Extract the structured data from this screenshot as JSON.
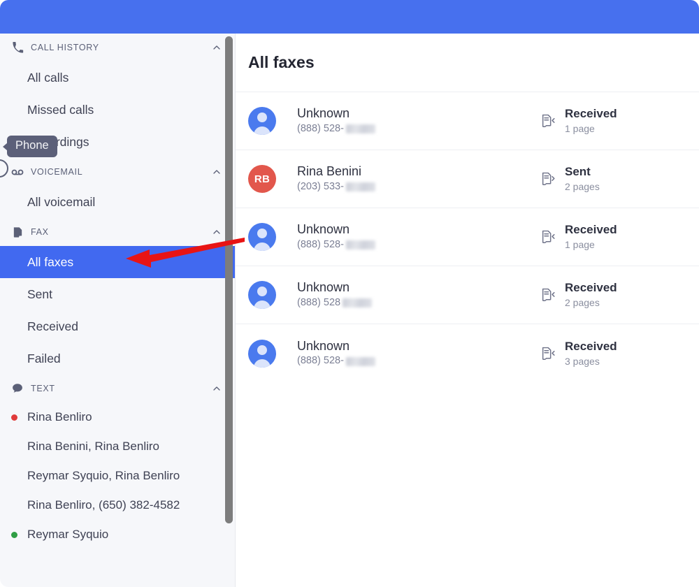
{
  "window": {
    "topbar_color": "#4770ee",
    "accent_color": "#4169f0"
  },
  "tooltip": {
    "text": "Phone"
  },
  "sidebar": {
    "sections": [
      {
        "id": "call-history",
        "icon": "phone-icon",
        "title": "CALL HISTORY",
        "collapse_icon": "chevron-up-icon",
        "items": [
          {
            "label": "All calls",
            "selected": false
          },
          {
            "label": "Missed calls",
            "selected": false
          },
          {
            "label": "Recordings",
            "selected": false
          }
        ]
      },
      {
        "id": "voicemail",
        "icon": "voicemail-icon",
        "title": "VOICEMAIL",
        "collapse_icon": "chevron-up-icon",
        "items": [
          {
            "label": "All voicemail",
            "selected": false
          }
        ]
      },
      {
        "id": "fax",
        "icon": "fax-document-icon",
        "title": "FAX",
        "collapse_icon": "chevron-up-icon",
        "items": [
          {
            "label": "All faxes",
            "selected": true
          },
          {
            "label": "Sent",
            "selected": false
          },
          {
            "label": "Received",
            "selected": false
          },
          {
            "label": "Failed",
            "selected": false
          }
        ]
      },
      {
        "id": "text",
        "icon": "chat-bubble-icon",
        "title": "TEXT",
        "collapse_icon": "chevron-up-icon",
        "threads": [
          {
            "label": "Rina Benliro",
            "dot": "red"
          },
          {
            "label": "Rina Benini, Rina Benliro",
            "dot": "none"
          },
          {
            "label": "Reymar Syquio, Rina Benliro",
            "dot": "none"
          },
          {
            "label": "Rina Benliro, (650) 382-4582",
            "dot": "none"
          },
          {
            "label": "Reymar Syquio",
            "dot": "green"
          }
        ]
      }
    ]
  },
  "main": {
    "title": "All faxes",
    "rows": [
      {
        "name": "Unknown",
        "phone": "(888) 528-",
        "redacted": true,
        "avatar_type": "unknown",
        "avatar_initials": "",
        "avatar_color": "#4a7aee",
        "direction": "Received",
        "direction_icon": "fax-received-icon",
        "pages": "1 page"
      },
      {
        "name": "Rina Benini",
        "phone": "(203) 533-",
        "redacted": true,
        "avatar_type": "initials",
        "avatar_initials": "RB",
        "avatar_color": "#e2574c",
        "direction": "Sent",
        "direction_icon": "fax-sent-icon",
        "pages": "2 pages"
      },
      {
        "name": "Unknown",
        "phone": "(888) 528-",
        "redacted": true,
        "avatar_type": "unknown",
        "avatar_initials": "",
        "avatar_color": "#4a7aee",
        "direction": "Received",
        "direction_icon": "fax-received-icon",
        "pages": "1 page"
      },
      {
        "name": "Unknown",
        "phone": "(888) 528 ",
        "redacted": true,
        "avatar_type": "unknown",
        "avatar_initials": "",
        "avatar_color": "#4a7aee",
        "direction": "Received",
        "direction_icon": "fax-received-icon",
        "pages": "2 pages"
      },
      {
        "name": "Unknown",
        "phone": "(888) 528-",
        "redacted": true,
        "avatar_type": "unknown",
        "avatar_initials": "",
        "avatar_color": "#4a7aee",
        "direction": "Received",
        "direction_icon": "fax-received-icon",
        "pages": "3 pages"
      }
    ]
  },
  "annotation": {
    "arrow_color": "#e81414",
    "points_to": "FAX"
  }
}
